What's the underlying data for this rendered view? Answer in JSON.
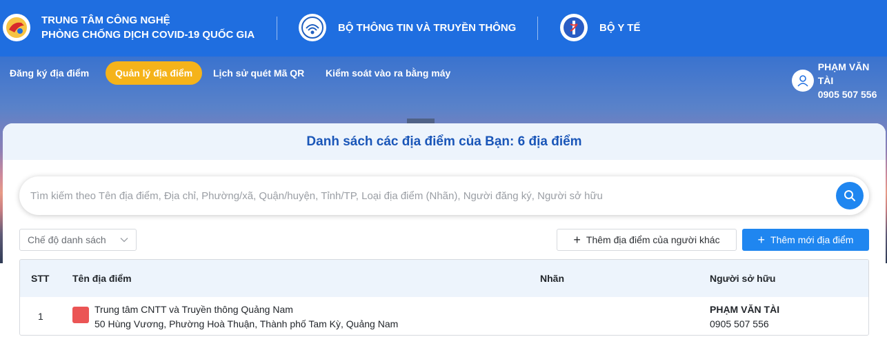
{
  "header": {
    "org1_line1": "TRUNG TÂM CÔNG NGHỆ",
    "org1_line2": "PHÒNG CHỐNG DỊCH COVID-19 QUỐC GIA",
    "org2": "BỘ THÔNG TIN VÀ TRUYỀN THÔNG",
    "org3": "BỘ Y TẾ"
  },
  "nav": {
    "items": [
      "Đăng ký địa điểm",
      "Quản lý địa điểm",
      "Lịch sử quét Mã QR",
      "Kiểm soát vào ra bằng máy"
    ],
    "active_index": 1
  },
  "user": {
    "name": "PHẠM VĂN TÀI",
    "phone": "0905 507 556"
  },
  "main": {
    "title": "Danh sách các địa điểm của Bạn: 6 địa điểm",
    "search_placeholder": "Tìm kiếm theo Tên địa điểm, Địa chỉ, Phường/xã, Quận/huyện, Tỉnh/TP, Loại địa điểm (Nhãn), Người đăng ký, Người sở hữu",
    "mode_select": "Chế độ danh sách",
    "add_other_label": "Thêm địa điểm của người khác",
    "add_new_label": "Thêm mới địa điểm"
  },
  "table": {
    "columns": [
      "STT",
      "Tên địa điểm",
      "Nhãn",
      "Người sở hữu"
    ],
    "rows": [
      {
        "stt": "1",
        "name": "Trung tâm CNTT và Truyền thông Quảng Nam",
        "address": "50 Hùng Vương, Phường Hoà Thuận, Thành phố Tam Kỳ, Quảng Nam",
        "tag": "",
        "owner_name": "PHẠM VĂN TÀI",
        "owner_phone": "0905 507 556"
      }
    ]
  },
  "colors": {
    "header_blue": "#1f6ee0",
    "active_nav": "#f5b31a",
    "primary": "#1f86f0",
    "title_blue": "#1a56b8",
    "tag_red": "#eb5555"
  }
}
